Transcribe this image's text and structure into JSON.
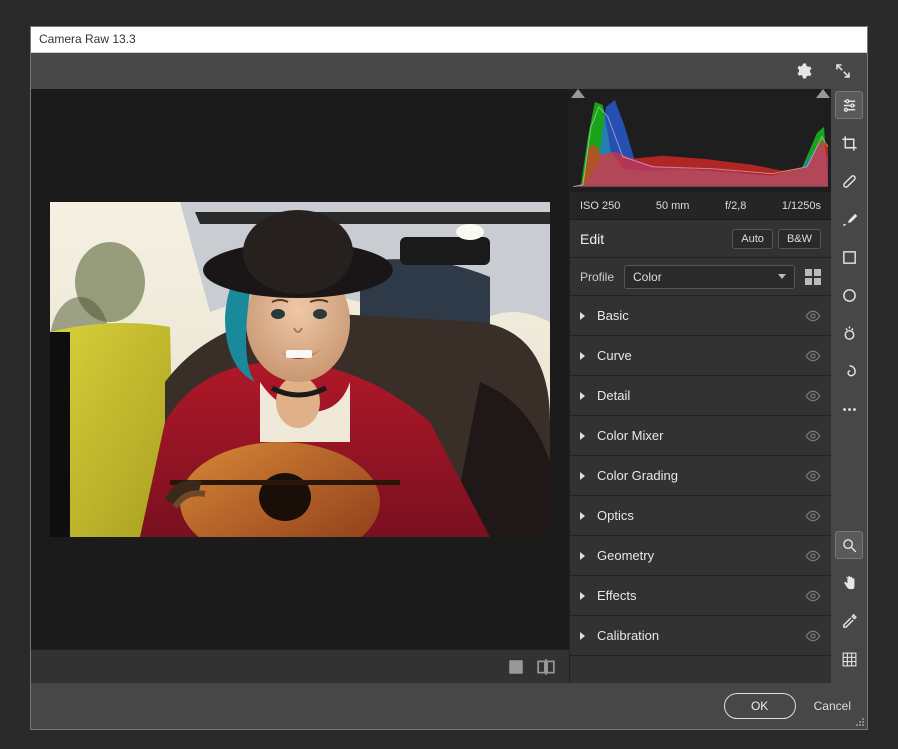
{
  "window": {
    "title": "Camera Raw 13.3"
  },
  "metadata": {
    "iso": "ISO 250",
    "focal": "50 mm",
    "aperture": "f/2,8",
    "shutter": "1/1250s"
  },
  "edit": {
    "title": "Edit",
    "auto": "Auto",
    "bw": "B&W"
  },
  "profile": {
    "label": "Profile",
    "value": "Color"
  },
  "panels": [
    {
      "label": "Basic"
    },
    {
      "label": "Curve"
    },
    {
      "label": "Detail"
    },
    {
      "label": "Color Mixer"
    },
    {
      "label": "Color Grading"
    },
    {
      "label": "Optics"
    },
    {
      "label": "Geometry"
    },
    {
      "label": "Effects"
    },
    {
      "label": "Calibration"
    }
  ],
  "footer": {
    "ok": "OK",
    "cancel": "Cancel"
  }
}
